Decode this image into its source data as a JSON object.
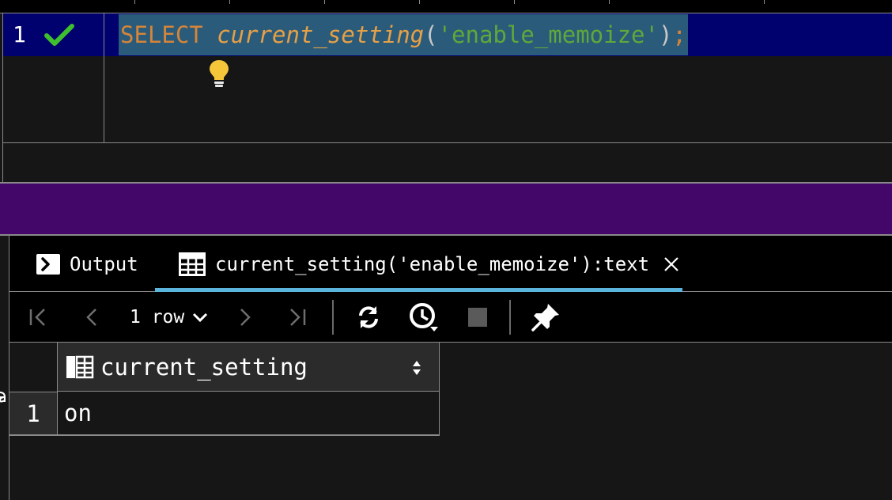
{
  "editor": {
    "line_number": "1",
    "code": {
      "keyword": "SELECT ",
      "function": "current_setting",
      "open_paren": "(",
      "string": "'enable_memoize'",
      "close_paren": ")",
      "semicolon": ";"
    },
    "status_icon": "check-icon",
    "hint_icon": "lightbulb-icon"
  },
  "results": {
    "tabs": [
      {
        "label": "Output",
        "icon": "console-icon"
      },
      {
        "label": "current_setting('enable_memoize'):text",
        "icon": "table-icon",
        "active": true
      }
    ],
    "toolbar": {
      "row_count_label": "1 row",
      "icons": [
        "first-page-icon",
        "previous-page-icon",
        "next-page-icon",
        "last-page-icon",
        "refresh-icon",
        "history-icon",
        "stop-icon",
        "pin-icon"
      ]
    },
    "grid": {
      "columns": [
        "current_setting"
      ],
      "rows": [
        {
          "num": "1",
          "values": [
            "on"
          ]
        }
      ]
    }
  },
  "colors": {
    "line_highlight": "#00006e",
    "selection": "#2b5b7a",
    "keyword": "#d4853a",
    "string": "#5fa83a",
    "divider_bar": "#43076a",
    "tab_underline": "#5ab4dc",
    "check": "#3dbf2e",
    "bulb": "#f5c63a"
  }
}
